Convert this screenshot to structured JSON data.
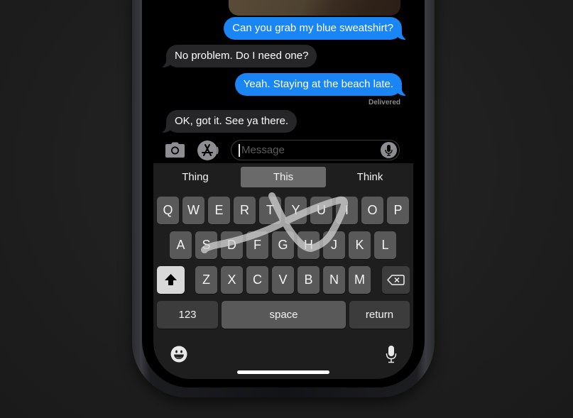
{
  "conversation": {
    "messages": [
      {
        "type": "sent",
        "text": "Can you grab my blue sweatshirt?"
      },
      {
        "type": "received",
        "text": "No problem. Do I need one?"
      },
      {
        "type": "sent",
        "text": "Yeah. Staying at the beach late."
      },
      {
        "type": "received",
        "text": "OK, got it. See ya there."
      }
    ],
    "status": "Delivered"
  },
  "compose": {
    "camera_icon": "camera-icon",
    "appstore_icon": "app-store-icon",
    "placeholder": "Message",
    "value": "",
    "mic_icon": "microphone-icon"
  },
  "keyboard": {
    "suggestions": [
      {
        "label": "Thing",
        "selected": false
      },
      {
        "label": "This",
        "selected": true
      },
      {
        "label": "Think",
        "selected": false
      }
    ],
    "rows": [
      [
        "Q",
        "W",
        "E",
        "R",
        "T",
        "Y",
        "U",
        "I",
        "O",
        "P"
      ],
      [
        "A",
        "S",
        "D",
        "F",
        "G",
        "H",
        "J",
        "K",
        "L"
      ],
      [
        "Z",
        "X",
        "C",
        "V",
        "B",
        "N",
        "M"
      ]
    ],
    "shift_icon": "shift-arrow-icon",
    "delete_icon": "backspace-icon",
    "numbers_label": "123",
    "space_label": "space",
    "return_label": "return",
    "emoji_icon": "emoji-icon",
    "dictation_icon": "microphone-icon",
    "swipe_path_letters": [
      "T",
      "H",
      "I",
      "S"
    ]
  },
  "colors": {
    "sent_bubble": "#1a86f5",
    "received_bubble": "#262628",
    "key": "#595959",
    "special_key": "#3c3c3c",
    "keyboard_bg": "#1e1e1e"
  }
}
